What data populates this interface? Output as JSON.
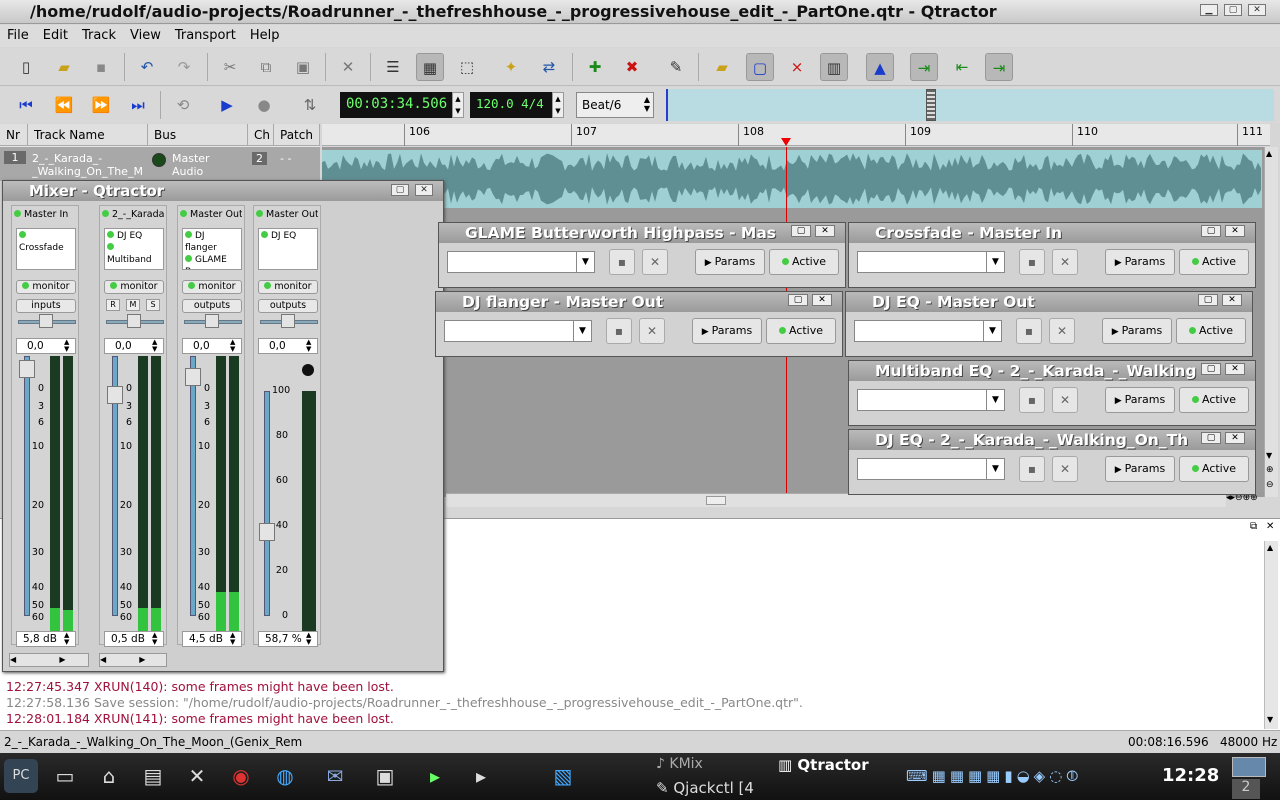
{
  "window": {
    "title": "/home/rudolf/audio-projects/Roadrunner_-_thefreshhouse_-_progressivehouse_edit_-_PartOne.qtr - Qtractor"
  },
  "menu": [
    "File",
    "Edit",
    "Track",
    "View",
    "Transport",
    "Help"
  ],
  "transport": {
    "time": "00:03:34.506",
    "tempo": "120.0 4/4",
    "snap": "Beat/6"
  },
  "tracklist": {
    "headers": [
      "Nr",
      "Track Name",
      "Bus",
      "Ch",
      "Patch"
    ],
    "row": {
      "nr": "1",
      "name": "2_-_Karada_-_Walking_On_The_M",
      "bus": "Master Audio",
      "ch": "2",
      "patch": "- -"
    }
  },
  "ruler": [
    "106",
    "107",
    "108",
    "109",
    "110",
    "111"
  ],
  "mixer": {
    "title": "Mixer - Qtractor",
    "strips": [
      {
        "name": "Master In",
        "fx": [
          "Crossfade"
        ],
        "monitor": "monitor",
        "io": "inputs",
        "pan": "0,0",
        "gain": "5,8 dB",
        "scale": [
          "0",
          "3",
          "6",
          "10",
          "20",
          "30",
          "40",
          "50",
          "60"
        ]
      },
      {
        "name": "2_-_Karada",
        "fx": [
          "DJ EQ",
          "Multiband"
        ],
        "monitor": "monitor",
        "rms": [
          "R",
          "M",
          "S"
        ],
        "pan": "0,0",
        "gain": "0,5 dB",
        "scale": [
          "0",
          "3",
          "6",
          "10",
          "20",
          "30",
          "40",
          "50",
          "60"
        ]
      },
      {
        "name": "Master Out",
        "fx": [
          "DJ flanger",
          "GLAME Bu"
        ],
        "monitor": "monitor",
        "io": "outputs",
        "pan": "0,0",
        "gain": "4,5 dB",
        "scale": [
          "0",
          "3",
          "6",
          "10",
          "20",
          "30",
          "40",
          "50",
          "60"
        ]
      },
      {
        "name": "Master Out",
        "fx": [
          "DJ EQ"
        ],
        "monitor": "monitor",
        "io": "outputs",
        "pan": "0,0",
        "gain": "58,7 %",
        "scale": [
          "100",
          "80",
          "60",
          "40",
          "20",
          "0"
        ]
      }
    ]
  },
  "plugins": [
    {
      "title": "GLAME Butterworth Highpass - Mas",
      "params": "Params",
      "active": "Active"
    },
    {
      "title": "Crossfade - Master In",
      "params": "Params",
      "active": "Active"
    },
    {
      "title": "DJ flanger - Master Out",
      "params": "Params",
      "active": "Active"
    },
    {
      "title": "DJ EQ - Master Out",
      "params": "Params",
      "active": "Active"
    },
    {
      "title": "Multiband EQ - 2_-_Karada_-_Walking",
      "params": "Params",
      "active": "Active"
    },
    {
      "title": "DJ EQ - 2_-_Karada_-_Walking_On_Th",
      "params": "Params",
      "active": "Active"
    }
  ],
  "messages": [
    {
      "text": "12:27:45.347 XRUN(140): some frames might have been lost.",
      "color": "#a0103c"
    },
    {
      "text": "12:27:58.136 Save session: \"/home/rudolf/audio-projects/Roadrunner_-_thefreshhouse_-_progressivehouse_edit_-_PartOne.qtr\".",
      "color": "#888888"
    },
    {
      "text": "12:28:01.184 XRUN(141): some frames might have been lost.",
      "color": "#a0103c"
    }
  ],
  "status": {
    "left": "2_-_Karada_-_Walking_On_The_Moon_(Genix_Rem",
    "time": "00:08:16.596",
    "rate": "48000 Hz"
  },
  "taskbar": {
    "kmix": "KMix",
    "qtractor": "Qtractor",
    "qjackctl": "Qjackctl [4",
    "clock": "12:28",
    "desk": "2"
  }
}
